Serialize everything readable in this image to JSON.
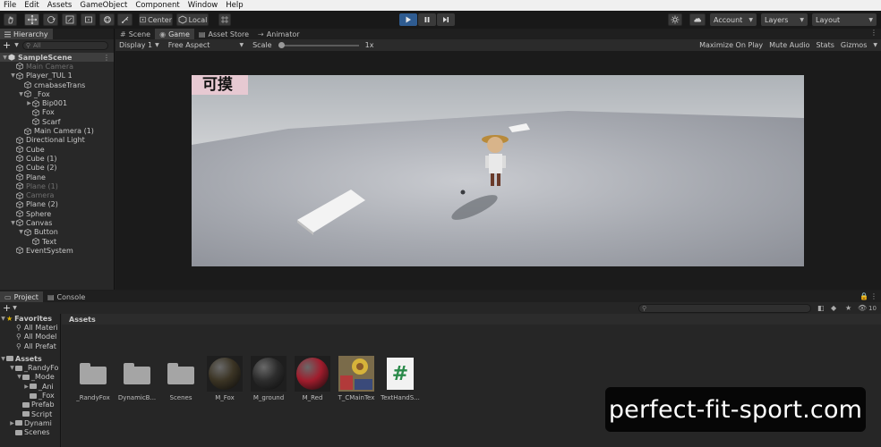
{
  "menu": [
    "File",
    "Edit",
    "Assets",
    "GameObject",
    "Component",
    "Window",
    "Help"
  ],
  "toolbar": {
    "pivot_label": "Center",
    "space_label": "Local",
    "account_label": "Account",
    "layers_label": "Layers",
    "layout_label": "Layout"
  },
  "hierarchy": {
    "tab_label": "Hierarchy",
    "search_placeholder": "All",
    "items": [
      {
        "label": "SampleScene",
        "depth": 0,
        "arrow": "▼",
        "selected": true
      },
      {
        "label": "Main Camera",
        "depth": 1,
        "dim": true
      },
      {
        "label": "Player_TUL 1",
        "depth": 1,
        "arrow": "▼"
      },
      {
        "label": "cmabaseTrans",
        "depth": 2
      },
      {
        "label": "_Fox",
        "depth": 2,
        "arrow": "▼"
      },
      {
        "label": "Bip001",
        "depth": 3,
        "arrow": "▶"
      },
      {
        "label": "Fox",
        "depth": 3
      },
      {
        "label": "Scarf",
        "depth": 3
      },
      {
        "label": "Main Camera (1)",
        "depth": 2
      },
      {
        "label": "Directional Light",
        "depth": 1
      },
      {
        "label": "Cube",
        "depth": 1
      },
      {
        "label": "Cube (1)",
        "depth": 1
      },
      {
        "label": "Cube (2)",
        "depth": 1
      },
      {
        "label": "Plane",
        "depth": 1
      },
      {
        "label": "Plane (1)",
        "depth": 1,
        "dim": true
      },
      {
        "label": "Camera",
        "depth": 1,
        "dim": true
      },
      {
        "label": "Plane (2)",
        "depth": 1
      },
      {
        "label": "Sphere",
        "depth": 1
      },
      {
        "label": "Canvas",
        "depth": 1,
        "arrow": "▼"
      },
      {
        "label": "Button",
        "depth": 2,
        "arrow": "▼"
      },
      {
        "label": "Text",
        "depth": 3
      },
      {
        "label": "EventSystem",
        "depth": 1
      }
    ]
  },
  "views": {
    "tabs": [
      "Scene",
      "Game",
      "Asset Store",
      "Animator"
    ],
    "selected_tab": "Game",
    "display": "Display 1",
    "aspect": "Free Aspect",
    "scale_label": "Scale",
    "scale_value": "1x",
    "right_buttons": [
      "Maximize On Play",
      "Mute Audio",
      "Stats",
      "Gizmos"
    ],
    "game_ui_text": "可摸"
  },
  "project": {
    "tabs": [
      "Project",
      "Console"
    ],
    "favorites_label": "Favorites",
    "favorites": [
      "All Materi",
      "All Model",
      "All Prefat"
    ],
    "assets_root": "Assets",
    "tree": [
      {
        "label": "_RandyFo",
        "depth": 1,
        "arrow": "▼"
      },
      {
        "label": "_Mode",
        "depth": 2,
        "arrow": "▼"
      },
      {
        "label": "_Ani",
        "depth": 3,
        "arrow": "▶"
      },
      {
        "label": "_Fox",
        "depth": 3
      },
      {
        "label": "Prefab",
        "depth": 2
      },
      {
        "label": "Script",
        "depth": 2
      },
      {
        "label": "Dynami",
        "depth": 1,
        "arrow": "▶"
      },
      {
        "label": "Scenes",
        "depth": 1
      }
    ],
    "assets_header": "Assets",
    "hidden_count": "10",
    "assets": [
      {
        "name": "_RandyFox",
        "kind": "folder"
      },
      {
        "name": "DynamicB...",
        "kind": "folder"
      },
      {
        "name": "Scenes",
        "kind": "folder"
      },
      {
        "name": "M_Fox",
        "kind": "material",
        "color": "#3b3424"
      },
      {
        "name": "M_ground",
        "kind": "material",
        "color": "#2c2c2c"
      },
      {
        "name": "M_Red",
        "kind": "material",
        "color": "#a01c2c"
      },
      {
        "name": "T_CMainTex",
        "kind": "texture"
      },
      {
        "name": "TextHandS...",
        "kind": "script",
        "glyph": "#"
      }
    ]
  },
  "watermark": "perfect-fit-sport.com"
}
